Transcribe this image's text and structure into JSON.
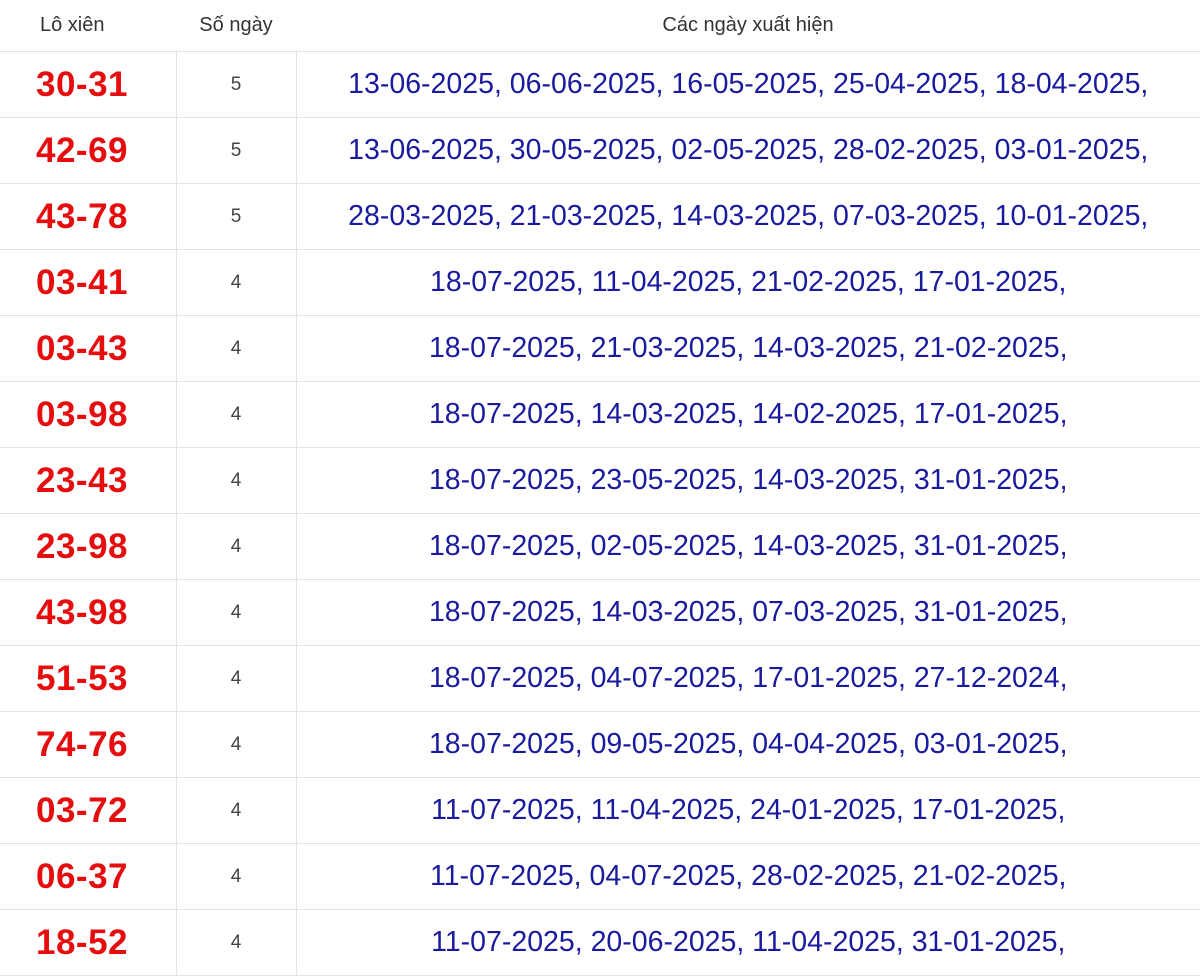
{
  "table": {
    "headers": [
      "Lô xiên",
      "Số ngày",
      "Các ngày xuất hiện"
    ],
    "rows": [
      {
        "pair": "30-31",
        "days": "5",
        "dates": "13-06-2025, 06-06-2025, 16-05-2025, 25-04-2025, 18-04-2025,"
      },
      {
        "pair": "42-69",
        "days": "5",
        "dates": "13-06-2025, 30-05-2025, 02-05-2025, 28-02-2025, 03-01-2025,"
      },
      {
        "pair": "43-78",
        "days": "5",
        "dates": "28-03-2025, 21-03-2025, 14-03-2025, 07-03-2025, 10-01-2025,"
      },
      {
        "pair": "03-41",
        "days": "4",
        "dates": "18-07-2025, 11-04-2025, 21-02-2025, 17-01-2025,"
      },
      {
        "pair": "03-43",
        "days": "4",
        "dates": "18-07-2025, 21-03-2025, 14-03-2025, 21-02-2025,"
      },
      {
        "pair": "03-98",
        "days": "4",
        "dates": "18-07-2025, 14-03-2025, 14-02-2025, 17-01-2025,"
      },
      {
        "pair": "23-43",
        "days": "4",
        "dates": "18-07-2025, 23-05-2025, 14-03-2025, 31-01-2025,"
      },
      {
        "pair": "23-98",
        "days": "4",
        "dates": "18-07-2025, 02-05-2025, 14-03-2025, 31-01-2025,"
      },
      {
        "pair": "43-98",
        "days": "4",
        "dates": "18-07-2025, 14-03-2025, 07-03-2025, 31-01-2025,"
      },
      {
        "pair": "51-53",
        "days": "4",
        "dates": "18-07-2025, 04-07-2025, 17-01-2025, 27-12-2024,"
      },
      {
        "pair": "74-76",
        "days": "4",
        "dates": "18-07-2025, 09-05-2025, 04-04-2025, 03-01-2025,"
      },
      {
        "pair": "03-72",
        "days": "4",
        "dates": "11-07-2025, 11-04-2025, 24-01-2025, 17-01-2025,"
      },
      {
        "pair": "06-37",
        "days": "4",
        "dates": "11-07-2025, 04-07-2025, 28-02-2025, 21-02-2025,"
      },
      {
        "pair": "18-52",
        "days": "4",
        "dates": "11-07-2025, 20-06-2025, 11-04-2025, 31-01-2025,"
      }
    ]
  }
}
